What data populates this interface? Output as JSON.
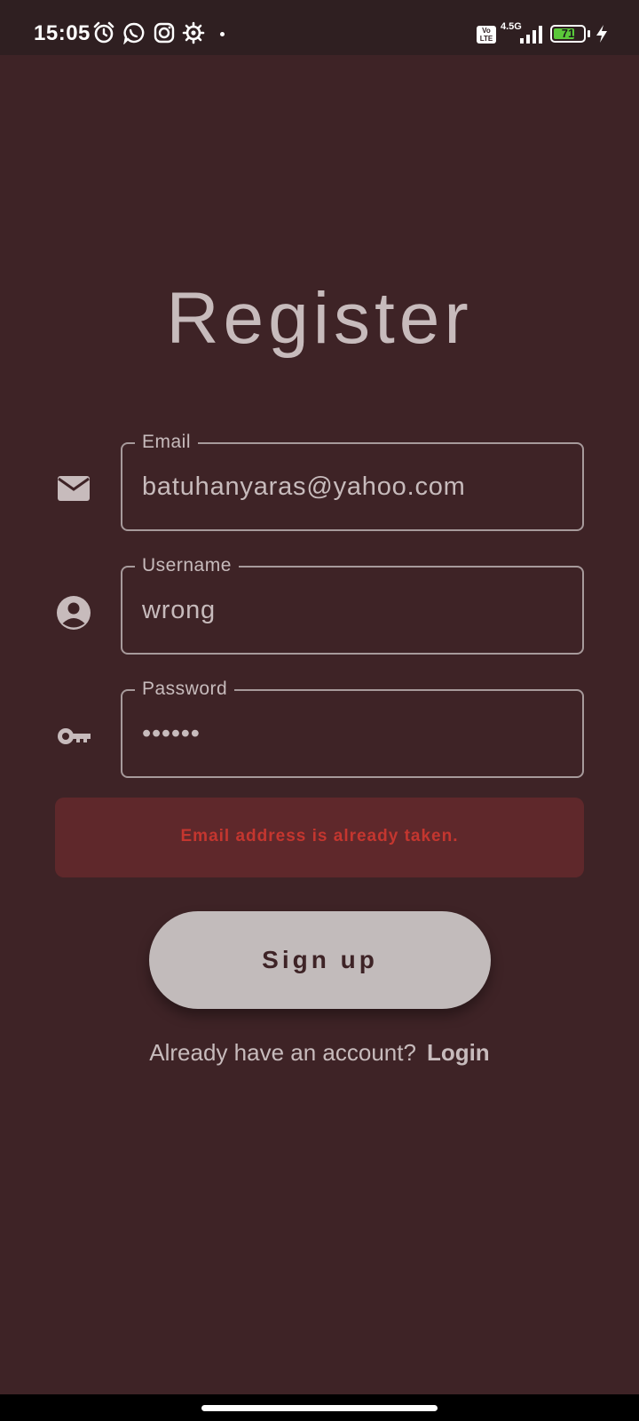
{
  "status_bar": {
    "time": "15:05",
    "volte": "Vo\nLTE",
    "network": "4.5G",
    "battery": "71",
    "battery_level": 0.71,
    "icons": [
      "alarm-icon",
      "whatsapp-icon",
      "instagram-icon",
      "settings-icon",
      "dot-icon",
      "volte-icon",
      "signal-icon",
      "battery-icon",
      "charging-icon"
    ]
  },
  "title": "Register",
  "form": {
    "email": {
      "label": "Email",
      "value": "batuhanyaras@yahoo.com",
      "icon": "email-icon"
    },
    "username": {
      "label": "Username",
      "value": "wrong",
      "icon": "account-circle-icon"
    },
    "password": {
      "label": "Password",
      "value": "••••••",
      "icon": "key-icon"
    }
  },
  "error": "Email address is already taken.",
  "signup_label": "Sign up",
  "footer": {
    "question": "Already have an account?",
    "login": "Login"
  },
  "colors": {
    "background": "#3e2326",
    "status_bar": "#2f1f21",
    "text": "#c7bbbc",
    "error_bg": "#5f282b",
    "error_text": "#c4362f",
    "button_bg": "#c2bbbb",
    "battery_green": "#5bc83a"
  }
}
